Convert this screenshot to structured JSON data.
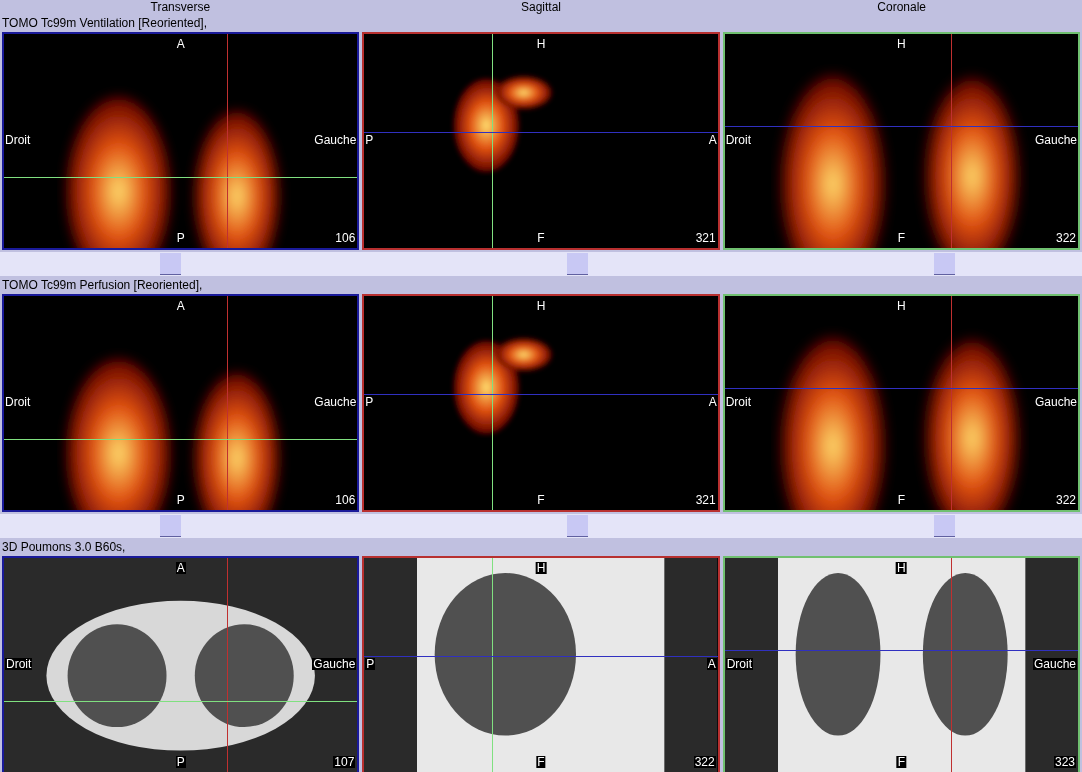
{
  "column_headers": [
    "Transverse",
    "Sagittal",
    "Coronale"
  ],
  "series": [
    {
      "title": "TOMO Tc99m Ventilation [Reoriented],",
      "kind": "nm",
      "views": [
        {
          "top": "A",
          "bottom": "P",
          "left": "Droit",
          "right": "Gauche",
          "slice": "106"
        },
        {
          "top": "H",
          "bottom": "F",
          "left": "P",
          "right": "A",
          "slice": "321"
        },
        {
          "top": "H",
          "bottom": "F",
          "left": "Droit",
          "right": "Gauche",
          "slice": "322"
        }
      ],
      "sliders": [
        {
          "level": 0.47
        },
        {
          "level": 0.6
        },
        {
          "level": 0.62
        }
      ]
    },
    {
      "title": "TOMO Tc99m Perfusion [Reoriented],",
      "kind": "nm",
      "views": [
        {
          "top": "A",
          "bottom": "P",
          "left": "Droit",
          "right": "Gauche",
          "slice": "106"
        },
        {
          "top": "H",
          "bottom": "F",
          "left": "P",
          "right": "A",
          "slice": "321"
        },
        {
          "top": "H",
          "bottom": "F",
          "left": "Droit",
          "right": "Gauche",
          "slice": "322"
        }
      ],
      "sliders": [
        {
          "level": 0.47
        },
        {
          "level": 0.6
        },
        {
          "level": 0.62
        }
      ]
    },
    {
      "title": "3D Poumons  3.0  B60s,",
      "kind": "ct",
      "views": [
        {
          "top": "A",
          "bottom": "P",
          "left": "Droit",
          "right": "Gauche",
          "slice": "107"
        },
        {
          "top": "H",
          "bottom": "F",
          "left": "P",
          "right": "A",
          "slice": "322"
        },
        {
          "top": "H",
          "bottom": "F",
          "left": "Droit",
          "right": "Gauche",
          "slice": "323"
        }
      ]
    }
  ]
}
